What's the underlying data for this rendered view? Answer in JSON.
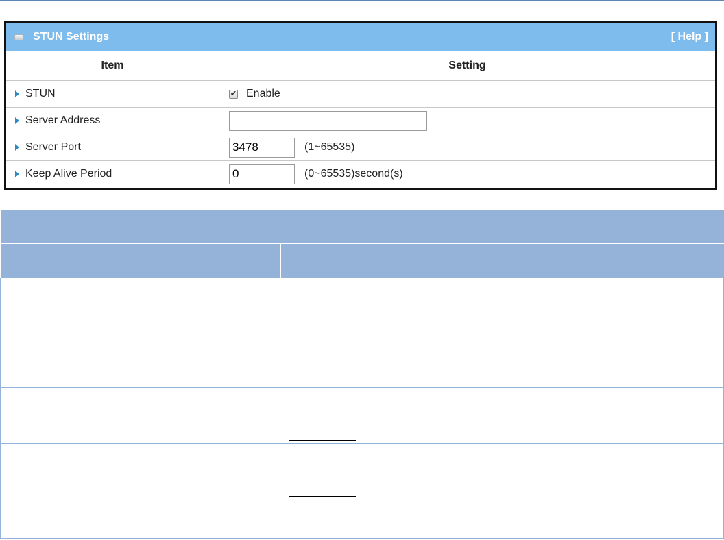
{
  "panel": {
    "title": "STUN Settings",
    "help": "[ Help ]",
    "headers": {
      "item": "Item",
      "setting": "Setting"
    },
    "rows": [
      {
        "label": "STUN",
        "checkbox_checked": true,
        "checkbox_label": "Enable"
      },
      {
        "label": "Server Address",
        "value": ""
      },
      {
        "label": "Server Port",
        "value": "3478",
        "hint": "(1~65535)"
      },
      {
        "label": "Keep Alive Period",
        "value": "0",
        "hint": "(0~65535)second(s)"
      }
    ]
  },
  "colors": {
    "panel_header": "#7fbcee",
    "desc_header": "#95b3d9",
    "arrow": "#2a8ac8"
  },
  "icons": [
    "panel-toggle-icon",
    "arrow-right-icon",
    "checkmark-icon"
  ]
}
